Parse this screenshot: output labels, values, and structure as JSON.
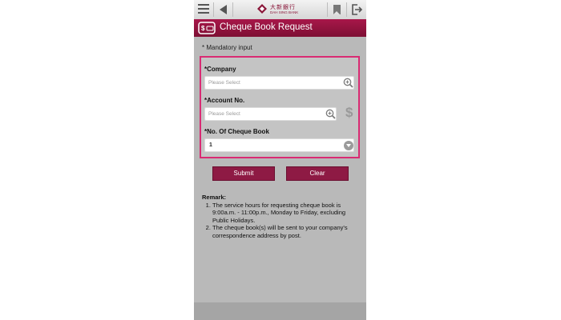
{
  "header": {
    "bank_name_cn": "大新銀行",
    "bank_name_en": "DAH SING BANK"
  },
  "page": {
    "title": "Cheque Book Request",
    "mandatory_note": "* Mandatory input"
  },
  "form": {
    "company": {
      "label": "*Company",
      "placeholder": "Please Select"
    },
    "account": {
      "label": "*Account No.",
      "placeholder": "Please Select"
    },
    "cheque_books": {
      "label": "*No. Of Cheque Book",
      "value": "1"
    }
  },
  "buttons": {
    "submit": "Submit",
    "clear": "Clear"
  },
  "remark": {
    "title": "Remark:",
    "items": [
      "The service hours for requesting cheque book is 9:00a.m. - 11:00p.m., Monday to Friday, excluding Public Holidays.",
      "The cheque book(s) will be sent to your company's correspondence address by post."
    ]
  },
  "colors": {
    "accent": "#8e1a44",
    "highlight_border": "#d92b73"
  },
  "icons": {
    "menu": "menu-icon",
    "back": "back-arrow-icon",
    "logo": "bank-logo-icon",
    "bookmark": "bookmark-icon",
    "logout": "logout-icon",
    "cheque": "cheque-icon",
    "zoom": "zoom-in-icon",
    "dollar": "dollar-icon",
    "dropdown": "chevron-down-icon"
  }
}
